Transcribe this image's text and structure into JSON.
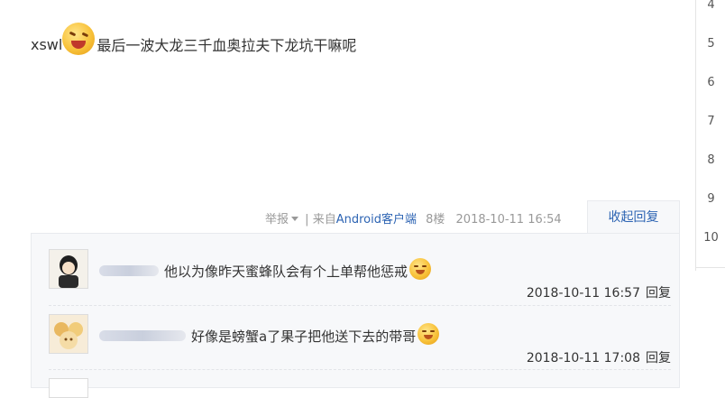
{
  "post": {
    "author": "xswl",
    "emoji_icon": "laughing-emoji-icon",
    "content": "最后一波大龙三千血奥拉夫下龙坑干嘛呢"
  },
  "meta": {
    "report": "举报",
    "separator": "|",
    "from_prefix": "来自",
    "client": "Android客户端",
    "floor": "8楼",
    "datetime": "2018-10-11 16:54"
  },
  "collapse_reply": "收起回复",
  "replies": [
    {
      "username_prefix": "",
      "text": "他以为像昨天蜜蜂队会有个上单帮他惩戒",
      "emoji_icon": "grin-emoji-icon",
      "time": "2018-10-11 16:57",
      "reply_label": "回复"
    },
    {
      "username_prefix": "",
      "text": "好像是螃蟹a了果子把他送下去的带哥",
      "emoji_icon": "laughing-emoji-icon",
      "time": "2018-10-11 17:08",
      "reply_label": "回复"
    }
  ],
  "floor_nav": [
    "4",
    "5",
    "6",
    "7",
    "8",
    "9",
    "10"
  ],
  "colors": {
    "link": "#2d64b3",
    "reply_bg": "#f7f8fa",
    "meta_text": "#999999"
  }
}
